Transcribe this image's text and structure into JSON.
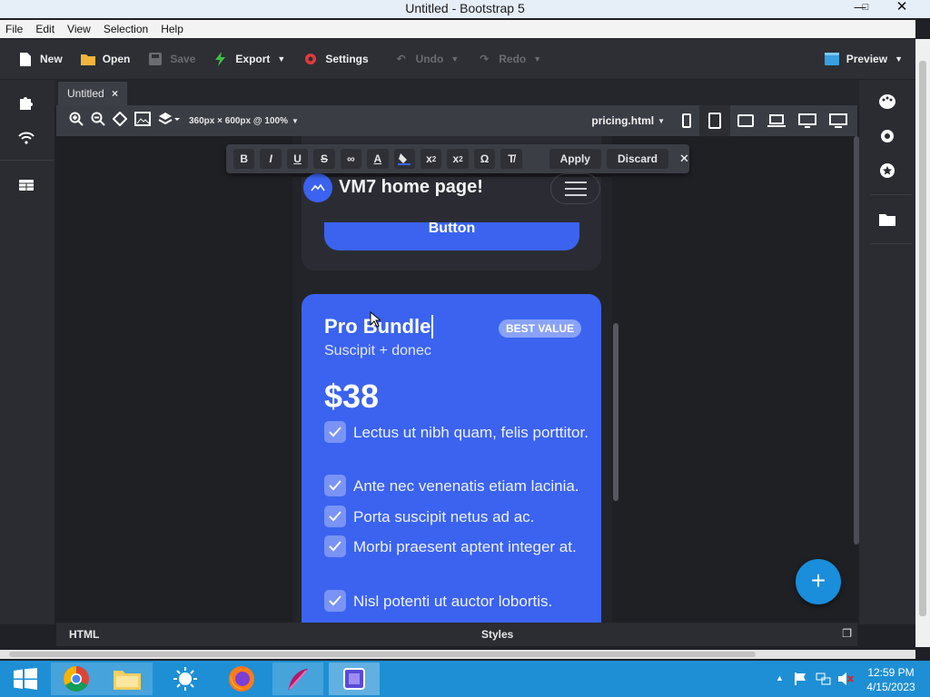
{
  "window": {
    "title": "Untitled - Bootstrap 5"
  },
  "menu": [
    "File",
    "Edit",
    "View",
    "Selection",
    "Help"
  ],
  "toolbar": {
    "new": "New",
    "open": "Open",
    "save": "Save",
    "export": "Export",
    "settings": "Settings",
    "undo": "Undo",
    "redo": "Redo",
    "preview": "Preview"
  },
  "tab": {
    "label": "Untitled",
    "close": "×"
  },
  "viewbar": {
    "size": "360px × 600px @ 100%",
    "file": "pricing.html"
  },
  "format": {
    "apply": "Apply",
    "discard": "Discard"
  },
  "preview": {
    "brand": "VM7 home page!",
    "button": "Button",
    "card": {
      "title": "Pro Bundle",
      "badge": "BEST VALUE",
      "subtitle": "Suscipit + donec",
      "price": "$38",
      "features": [
        "Lectus ut nibh quam, felis porttitor.",
        "Ante nec venenatis etiam lacinia.",
        "Porta suscipit netus ad ac.",
        "Morbi praesent aptent integer at.",
        "Nisl potenti ut auctor lobortis."
      ]
    }
  },
  "bottom": {
    "html": "HTML",
    "styles": "Styles"
  },
  "clock": {
    "time": "12:59 PM",
    "date": "4/15/2023"
  },
  "colors": {
    "accent": "#3b63f0",
    "taskbar": "#1e8fd4",
    "fab": "#1a8ddb"
  }
}
